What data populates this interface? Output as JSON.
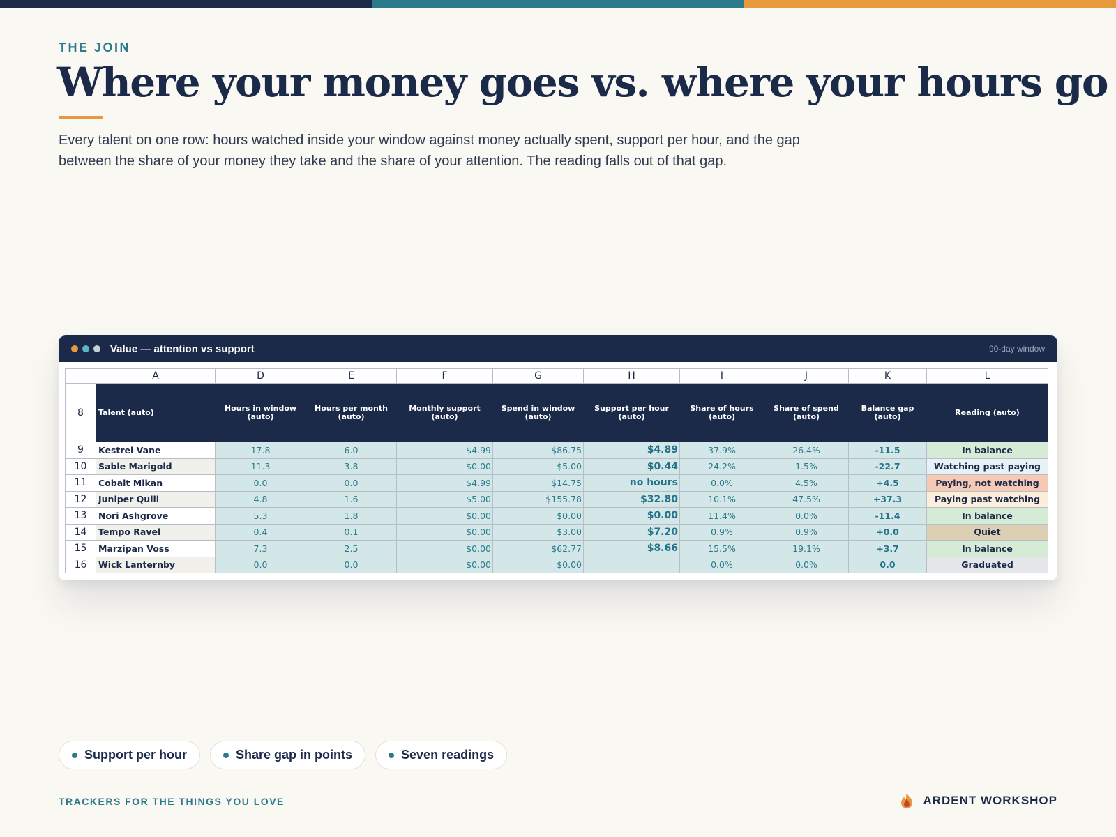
{
  "accent_colors": {
    "navy": "#1c2a4a",
    "teal": "#2b7a8c",
    "orange": "#e8993d"
  },
  "eyebrow": "THE JOIN",
  "title": "Where your money goes vs. where your hours go",
  "lede": "Every talent on one row: hours watched inside your window against money actually spent, support per hour, and the gap between the share of your money they take and the share of your attention. The reading falls out of that gap.",
  "window": {
    "title": "Value — attention vs support",
    "badge": "90-day window",
    "dots": [
      "#e8993d",
      "#5cb8c0",
      "#c9cdd6"
    ]
  },
  "sheet": {
    "column_letters": [
      "A",
      "D",
      "E",
      "F",
      "G",
      "H",
      "I",
      "J",
      "K",
      "L"
    ],
    "header_row_number": "8",
    "headers": [
      "Talent (auto)",
      "Hours in window (auto)",
      "Hours per month (auto)",
      "Monthly support (auto)",
      "Spend in window (auto)",
      "Support per hour (auto)",
      "Share of hours (auto)",
      "Share of spend (auto)",
      "Balance gap (auto)",
      "Reading (auto)"
    ],
    "rows": [
      {
        "num": "9",
        "talent": "Kestrel Vane",
        "hours_window": "17.8",
        "hours_month": "6.0",
        "monthly_support": "$4.99",
        "spend_window": "$86.75",
        "support_per_hour": "$4.89",
        "share_hours": "37.9%",
        "share_spend": "26.4%",
        "balance_gap": "-11.5",
        "reading": "In balance",
        "reading_color": "#d6ebd6"
      },
      {
        "num": "10",
        "talent": "Sable Marigold",
        "hours_window": "11.3",
        "hours_month": "3.8",
        "monthly_support": "$0.00",
        "spend_window": "$5.00",
        "support_per_hour": "$0.44",
        "share_hours": "24.2%",
        "share_spend": "1.5%",
        "balance_gap": "-22.7",
        "reading": "Watching past paying",
        "reading_color": "#e8f1f7"
      },
      {
        "num": "11",
        "talent": "Cobalt Mikan",
        "hours_window": "0.0",
        "hours_month": "0.0",
        "monthly_support": "$4.99",
        "spend_window": "$14.75",
        "support_per_hour": "no hours",
        "share_hours": "0.0%",
        "share_spend": "4.5%",
        "balance_gap": "+4.5",
        "reading": "Paying, not watching",
        "reading_color": "#f6c9b5"
      },
      {
        "num": "12",
        "talent": "Juniper Quill",
        "hours_window": "4.8",
        "hours_month": "1.6",
        "monthly_support": "$5.00",
        "spend_window": "$155.78",
        "support_per_hour": "$32.80",
        "share_hours": "10.1%",
        "share_spend": "47.5%",
        "balance_gap": "+37.3",
        "reading": "Paying past watching",
        "reading_color": "#fbeedb"
      },
      {
        "num": "13",
        "talent": "Nori Ashgrove",
        "hours_window": "5.3",
        "hours_month": "1.8",
        "monthly_support": "$0.00",
        "spend_window": "$0.00",
        "support_per_hour": "$0.00",
        "share_hours": "11.4%",
        "share_spend": "0.0%",
        "balance_gap": "-11.4",
        "reading": "In balance",
        "reading_color": "#d6ebd6"
      },
      {
        "num": "14",
        "talent": "Tempo Ravel",
        "hours_window": "0.4",
        "hours_month": "0.1",
        "monthly_support": "$0.00",
        "spend_window": "$3.00",
        "support_per_hour": "$7.20",
        "share_hours": "0.9%",
        "share_spend": "0.9%",
        "balance_gap": "+0.0",
        "reading": "Quiet",
        "reading_color": "#dccfb4"
      },
      {
        "num": "15",
        "talent": "Marzipan Voss",
        "hours_window": "7.3",
        "hours_month": "2.5",
        "monthly_support": "$0.00",
        "spend_window": "$62.77",
        "support_per_hour": "$8.66",
        "share_hours": "15.5%",
        "share_spend": "19.1%",
        "balance_gap": "+3.7",
        "reading": "In balance",
        "reading_color": "#d6ebd6"
      },
      {
        "num": "16",
        "talent": "Wick Lanternby",
        "hours_window": "0.0",
        "hours_month": "0.0",
        "monthly_support": "$0.00",
        "spend_window": "$0.00",
        "support_per_hour": "",
        "share_hours": "0.0%",
        "share_spend": "0.0%",
        "balance_gap": "0.0",
        "reading": "Graduated",
        "reading_color": "#e4e6ea"
      }
    ]
  },
  "chips": [
    "Support per hour",
    "Share gap in points",
    "Seven readings"
  ],
  "footer": {
    "tagline": "TRACKERS FOR THE THINGS YOU LOVE",
    "brand": "ARDENT WORKSHOP",
    "brand_icon": "flame-icon"
  }
}
